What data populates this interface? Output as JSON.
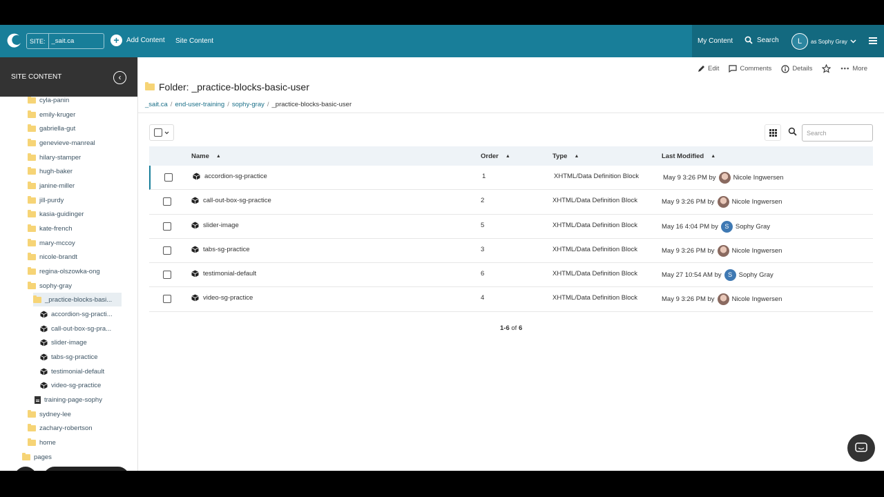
{
  "topbar": {
    "site_label": "SITE:",
    "site_value": "_sait.ca",
    "add_content": "Add Content",
    "site_content": "Site Content",
    "my_content": "My Content",
    "search": "Search",
    "user_initial": "L",
    "user_label": "as Sophy Gray"
  },
  "sidebar": {
    "title": "SITE CONTENT",
    "items": [
      {
        "label": "cyla-panin",
        "type": "folder"
      },
      {
        "label": "emily-kruger",
        "type": "folder"
      },
      {
        "label": "gabriella-gut",
        "type": "folder"
      },
      {
        "label": "genevieve-manreal",
        "type": "folder"
      },
      {
        "label": "hilary-stamper",
        "type": "folder"
      },
      {
        "label": "hugh-baker",
        "type": "folder"
      },
      {
        "label": "janine-miller",
        "type": "folder"
      },
      {
        "label": "jill-purdy",
        "type": "folder"
      },
      {
        "label": "kasia-guidinger",
        "type": "folder"
      },
      {
        "label": "kate-french",
        "type": "folder"
      },
      {
        "label": "mary-mccoy",
        "type": "folder"
      },
      {
        "label": "nicole-brandt",
        "type": "folder"
      },
      {
        "label": "regina-olszowka-ong",
        "type": "folder"
      },
      {
        "label": "sophy-gray",
        "type": "folder"
      },
      {
        "label": "_practice-blocks-basi...",
        "type": "folder"
      },
      {
        "label": "accordion-sg-practi...",
        "type": "block"
      },
      {
        "label": "call-out-box-sg-pra...",
        "type": "block"
      },
      {
        "label": "slider-image",
        "type": "block"
      },
      {
        "label": "tabs-sg-practice",
        "type": "block"
      },
      {
        "label": "testimonial-default",
        "type": "block"
      },
      {
        "label": "video-sg-practice",
        "type": "block"
      },
      {
        "label": "training-page-sophy",
        "type": "page"
      },
      {
        "label": "sydney-lee",
        "type": "folder"
      },
      {
        "label": "zachary-robertson",
        "type": "folder"
      },
      {
        "label": "home",
        "type": "folder"
      },
      {
        "label": "pages",
        "type": "folder"
      }
    ]
  },
  "actions": {
    "edit": "Edit",
    "comments": "Comments",
    "details": "Details",
    "more": "More"
  },
  "folder": {
    "title": "Folder: _practice-blocks-basic-user",
    "breadcrumb": [
      "_sait.ca",
      "end-user-training",
      "sophy-gray",
      "_practice-blocks-basic-user"
    ]
  },
  "search_placeholder": "Search",
  "table": {
    "headers": {
      "name": "Name",
      "order": "Order",
      "type": "Type",
      "modified": "Last Modified"
    },
    "rows": [
      {
        "name": "accordion-sg-practice",
        "order": "1",
        "type": "XHTML/Data Definition Block",
        "modified": "May 9 3:26 PM by",
        "user": "Nicole Ingwersen",
        "avatar": "photo",
        "initial": ""
      },
      {
        "name": "call-out-box-sg-practice",
        "order": "2",
        "type": "XHTML/Data Definition Block",
        "modified": "May 9 3:26 PM by",
        "user": "Nicole Ingwersen",
        "avatar": "photo",
        "initial": ""
      },
      {
        "name": "slider-image",
        "order": "5",
        "type": "XHTML/Data Definition Block",
        "modified": "May 16 4:04 PM by",
        "user": "Sophy Gray",
        "avatar": "letter",
        "initial": "S"
      },
      {
        "name": "tabs-sg-practice",
        "order": "3",
        "type": "XHTML/Data Definition Block",
        "modified": "May 9 3:26 PM by",
        "user": "Nicole Ingwersen",
        "avatar": "photo",
        "initial": ""
      },
      {
        "name": "testimonial-default",
        "order": "6",
        "type": "XHTML/Data Definition Block",
        "modified": "May 27 10:54 AM by",
        "user": "Sophy Gray",
        "avatar": "letter",
        "initial": "S"
      },
      {
        "name": "video-sg-practice",
        "order": "4",
        "type": "XHTML/Data Definition Block",
        "modified": "May 9 3:26 PM by",
        "user": "Nicole Ingwersen",
        "avatar": "photo",
        "initial": ""
      }
    ]
  },
  "pager": {
    "range": "1-6",
    "of": "of",
    "total": "6"
  },
  "colors": {
    "topbar": "#187e99",
    "topbar_right": "#13697f",
    "sidebar_head": "#333333",
    "table_head": "#eef3f7"
  }
}
